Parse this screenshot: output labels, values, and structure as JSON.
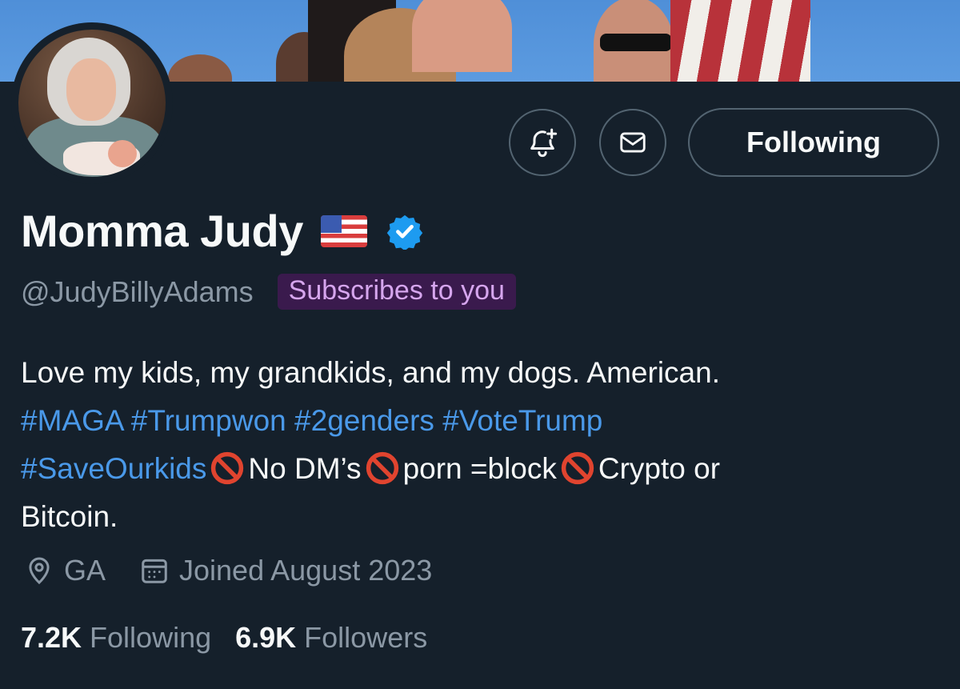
{
  "profile": {
    "display_name": "Momma Judy",
    "handle": "@JudyBillyAdams",
    "subscribes_badge": "Subscribes to you",
    "follow_button_label": "Following",
    "bio": {
      "line1": "Love my kids, my grandkids, and my dogs. American.",
      "hashtags_line": [
        "#MAGA",
        "#Trumpwon",
        "#2genders",
        "#VoteTrump"
      ],
      "line3_tag": "#SaveOurkids",
      "line3_seg1": "No DM’s",
      "line3_seg2": "porn =block",
      "line3_seg3": "Crypto or",
      "line4": "Bitcoin."
    },
    "location": "GA",
    "joined": "Joined August 2023",
    "following_count": "7.2K",
    "following_label": "Following",
    "followers_count": "6.9K",
    "followers_label": "Followers"
  },
  "icons": {
    "notify": "bell-plus-icon",
    "message": "envelope-icon",
    "verified": "verified-badge-icon",
    "location": "location-pin-icon",
    "calendar": "calendar-icon",
    "flag": "us-flag-emoji",
    "prohibited": "no-entry-emoji"
  },
  "colors": {
    "background": "#15202b",
    "link": "#4a99e9",
    "secondary_text": "#8b98a5",
    "verified": "#1d9bf0",
    "badge_bg": "#3a1a4d",
    "badge_text": "#d6a6ee"
  }
}
